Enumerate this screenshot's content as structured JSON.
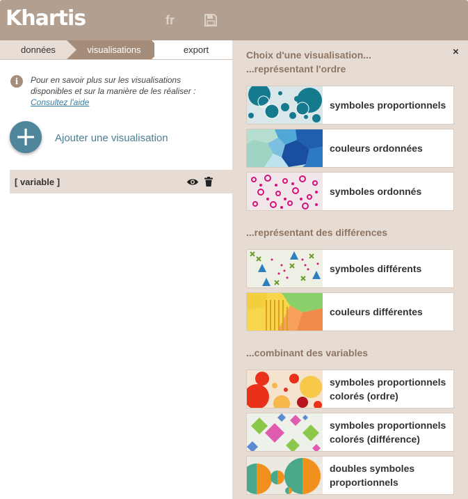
{
  "app": {
    "title": "Khartis",
    "lang": "fr"
  },
  "steps": [
    "données",
    "visualisations",
    "export"
  ],
  "info": {
    "text": "Pour en savoir plus sur les visualisations disponibles et sur la manière de les réaliser :",
    "link": "Consultez l'aide"
  },
  "add": {
    "symbol": "+",
    "label": "Ajouter une visualisation"
  },
  "variable": {
    "label": "[ variable ]"
  },
  "panel": {
    "title_line1": "Choix d'une visualisation...",
    "section_order": "...représentant l'ordre",
    "section_diff": "...représentant des différences",
    "section_combine": "...combinant des variables",
    "close": "×",
    "cards": [
      "symboles proportionnels",
      "couleurs ordonnées",
      "symboles ordonnés",
      "symboles différents",
      "couleurs différentes",
      "symboles proportionnels colorés (ordre)",
      "symboles proportionnels colorés (différence)",
      "doubles symboles proportionnels"
    ]
  },
  "colors": {
    "header": "#b39f8f",
    "panel": "#e6dcd3",
    "accent": "#4f869c",
    "step_active": "#a58d79"
  },
  "icons": [
    "info-icon",
    "save-icon",
    "eye-icon",
    "trash-icon",
    "close-icon",
    "plus-icon"
  ]
}
